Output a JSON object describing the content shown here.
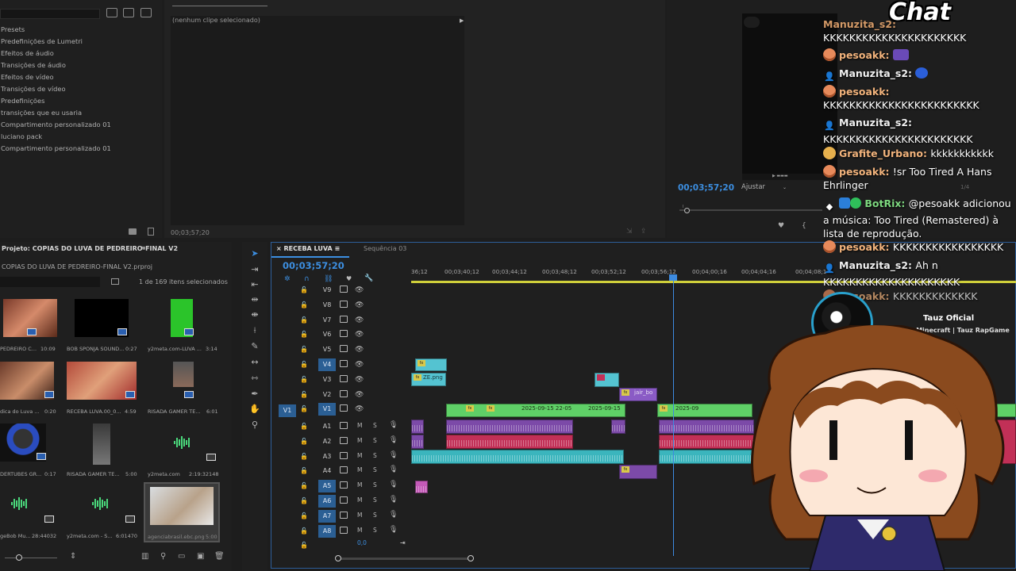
{
  "effects_panel": {
    "items": [
      "Presets",
      "Predefinições de Lumetri",
      "Efeitos de áudio",
      "Transições de áudio",
      "Efeitos de vídeo",
      "Transições de vídeo",
      "Predefinições",
      "transições que eu usaria",
      "Compartimento personalizado 01",
      "luciano pack",
      "Compartimento personalizado 01"
    ]
  },
  "source_monitor": {
    "no_clip": "(nenhum clipe selecionado)",
    "timecode": "00;03;57;20"
  },
  "program_monitor": {
    "timecode": "00;03;57;20",
    "fit": "Ajustar",
    "fraction": "1/4"
  },
  "project": {
    "title": "Projeto: COPIAS DO LUVA DE PEDREIRO-FINAL V2",
    "file": "COPIAS DO LUVA DE PEDREIRO-FINAL V2.prproj",
    "selection": "1 de 169 itens selecionados",
    "items": [
      {
        "label": "PEDREIRO C...",
        "dur": "10:09"
      },
      {
        "label": "BOB SPONJA SOUND...",
        "dur": "0:27"
      },
      {
        "label": "y2meta.com-LUVA ...",
        "dur": "3:14"
      },
      {
        "label": "dica do Luva ...",
        "dur": "0:20"
      },
      {
        "label": "RECEBA LUVA.00_0...",
        "dur": "4:59"
      },
      {
        "label": "RISADA GAMER TE...",
        "dur": "6:01"
      },
      {
        "label": "DERTUBES GR...",
        "dur": "0:17"
      },
      {
        "label": "RISADA GAMER TE...",
        "dur": "5:00"
      },
      {
        "label": "y2meta.com",
        "dur": "2:19:32148"
      },
      {
        "label": "geBob Mu...",
        "dur": "28:44032"
      },
      {
        "label": "y2meta.com - S...",
        "dur": "6:01470"
      },
      {
        "label": "agenciabrasil.ebc.png",
        "dur": "5:00"
      }
    ]
  },
  "timeline": {
    "sequence_tab": "RECEBA LUVA",
    "other_tab": "Sequência 03",
    "timecode": "00;03;57;20",
    "zero_value": "0,0",
    "ticks": [
      "36;12",
      "00;03;40;12",
      "00;03;44;12",
      "00;03;48;12",
      "00;03;52;12",
      "00;03;56;12",
      "00;04;00;16",
      "00;04;04;16",
      "00;04;08;1"
    ],
    "video_tracks": [
      "V9",
      "V8",
      "V7",
      "V6",
      "V5",
      "V4",
      "V3",
      "V2",
      "V1"
    ],
    "audio_tracks": [
      "A1",
      "A2",
      "A3",
      "A4",
      "A5",
      "A6",
      "A7",
      "A8"
    ],
    "source_patch": "V1",
    "clip_labels": {
      "ze": "ZE.png",
      "jair": "jair_bo",
      "date1": "2025-09-15 22-05",
      "date2": "2025-09-15",
      "date3": "2025-09"
    },
    "mute": "M",
    "solo": "S"
  },
  "chat": {
    "title": "Chat",
    "messages": [
      {
        "user": "Manuzita_s2:",
        "text": "KKKKKKKKKKKKKKKKKKKKKK"
      },
      {
        "user": "pesoakk:",
        "text": ""
      },
      {
        "user": "Manuzita_s2:",
        "text": ""
      },
      {
        "user": "pesoakk:",
        "text": "KKKKKKKKKKKKKKKKKKKKKKKK"
      },
      {
        "user": "Manuzita_s2:",
        "text": "KKKKKKKKKKKKKKKKKKKKKKK"
      },
      {
        "user": "Grafite_Urbano:",
        "text": "kkkkkkkkkkk"
      },
      {
        "user": "pesoakk:",
        "text": "!sr Too Tired A Hans Ehrlinger"
      },
      {
        "user": "BotRix:",
        "text": "@pesoakk adicionou a música: Too Tired (Remastered) à lista de reprodução."
      },
      {
        "user": "pesoakk:",
        "text": "KKKKKKKKKKKKKKKKK"
      },
      {
        "user": "Manuzita_s2:",
        "text": "Ah n KKKKKKKKKKKKKKKKKKKKK"
      },
      {
        "user": "pesoakk:",
        "text": "KKKKKKKKKKKKK"
      }
    ]
  },
  "now_playing": {
    "artist": "Tauz Oficial",
    "track": "Rap do Minecraft | Tauz RapGame 06"
  },
  "colors": {
    "accent": "#3c8ee0",
    "video_clip": "#5fd067",
    "audio_clip": "#7c4aa8",
    "audio_red": "#c23057",
    "audio_teal": "#3bb5bd"
  }
}
